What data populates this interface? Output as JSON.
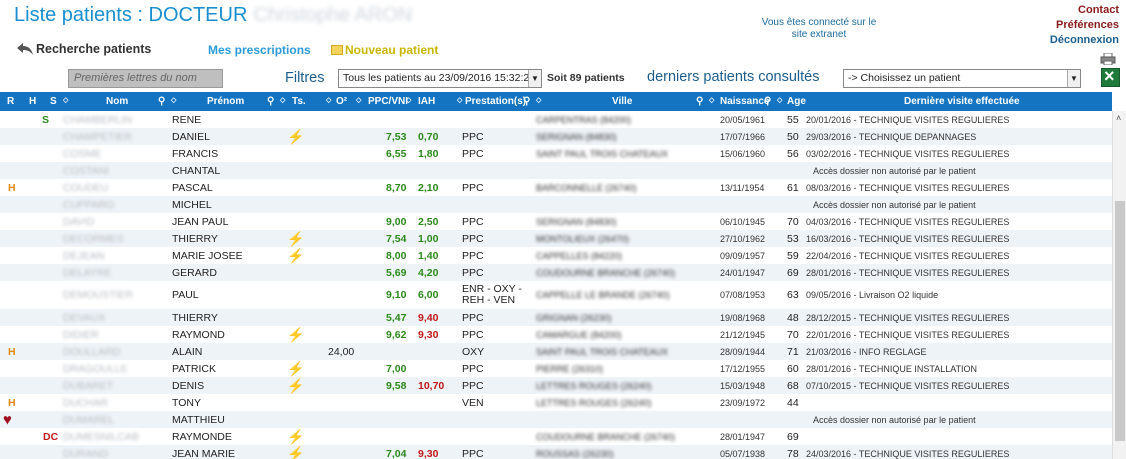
{
  "header": {
    "title": "Liste patients : DOCTEUR",
    "doctor_name": "Christophe ARON",
    "connected": "Vous êtes connecté sur le site extranet",
    "links": {
      "contact": "Contact",
      "preferences": "Préférences",
      "logout": "Déconnexion"
    }
  },
  "toolbar": {
    "back": "Recherche patients",
    "prescriptions": "Mes prescriptions",
    "new_patient": "Nouveau patient",
    "search_placeholder": "Premières lettres du nom",
    "filters_label": "Filtres",
    "filter_value": "Tous les patients au 23/09/2016 15:32:29",
    "count": "Soit 89 patients",
    "recent_label": "derniers patients consultés",
    "recent_value": "-> Choisissez un patient"
  },
  "columns": [
    "R",
    "H",
    "S",
    "Nom",
    "Prénom",
    "Ts.",
    "O²",
    "PPC/VNI",
    "IAH",
    "Prestation(s)",
    "Ville",
    "Naissance",
    "Age",
    "Dernière visite effectuée"
  ],
  "rows": [
    {
      "flag": "S",
      "flag_type": "S",
      "nom": "CHAMBERLIN",
      "prenom": "RENE",
      "ts": false,
      "o2": "",
      "ppc": "",
      "iah": "",
      "iah_red": false,
      "prest": "",
      "ville": "CARPENTRAS (84200)",
      "naissance": "20/05/1961",
      "age": "55",
      "visite": "20/01/2016 - TECHNIQUE VISITES REGULIERES"
    },
    {
      "flag": "",
      "flag_type": "",
      "nom": "CHAMPETIER",
      "prenom": "DANIEL",
      "ts": true,
      "o2": "",
      "ppc": "7,53",
      "iah": "0,70",
      "iah_red": false,
      "prest": "PPC",
      "ville": "SERIGNAN (84830)",
      "naissance": "17/07/1966",
      "age": "50",
      "visite": "29/03/2016 - TECHNIQUE DEPANNAGES"
    },
    {
      "flag": "",
      "flag_type": "",
      "nom": "COSME",
      "prenom": "FRANCIS",
      "ts": false,
      "o2": "",
      "ppc": "6,55",
      "iah": "1,80",
      "iah_red": false,
      "prest": "PPC",
      "ville": "SAINT PAUL TROIS CHATEAUX",
      "naissance": "15/06/1960",
      "age": "56",
      "visite": "03/02/2016 - TECHNIQUE VISITES REGULIERES"
    },
    {
      "flag": "",
      "flag_type": "",
      "nom": "COSTANI",
      "prenom": "CHANTAL",
      "ts": false,
      "o2": "",
      "ppc": "",
      "iah": "",
      "iah_red": false,
      "prest": "",
      "ville": "",
      "naissance": "",
      "age": "",
      "visite": "Accès dossier non autorisé par le patient"
    },
    {
      "flag": "H",
      "flag_type": "H",
      "nom": "COUDEU",
      "prenom": "PASCAL",
      "ts": false,
      "o2": "",
      "ppc": "8,70",
      "iah": "2,10",
      "iah_red": false,
      "prest": "PPC",
      "ville": "BARCONNELLE (26740)",
      "naissance": "13/11/1954",
      "age": "61",
      "visite": "08/03/2016 - TECHNIQUE VISITES REGULIERES"
    },
    {
      "flag": "",
      "flag_type": "",
      "nom": "CUPPARO",
      "prenom": "MICHEL",
      "ts": false,
      "o2": "",
      "ppc": "",
      "iah": "",
      "iah_red": false,
      "prest": "",
      "ville": "",
      "naissance": "",
      "age": "",
      "visite": "Accès dossier non autorisé par le patient"
    },
    {
      "flag": "",
      "flag_type": "",
      "nom": "DAVID",
      "prenom": "JEAN PAUL",
      "ts": false,
      "o2": "",
      "ppc": "9,00",
      "iah": "2,50",
      "iah_red": false,
      "prest": "PPC",
      "ville": "SERIGNAN (84830)",
      "naissance": "06/10/1945",
      "age": "70",
      "visite": "04/03/2016 - TECHNIQUE VISITES REGULIERES"
    },
    {
      "flag": "",
      "flag_type": "",
      "nom": "DECORMES",
      "prenom": "THIERRY",
      "ts": true,
      "o2": "",
      "ppc": "7,54",
      "iah": "1,00",
      "iah_red": false,
      "prest": "PPC",
      "ville": "MONTOLIEUX (26470)",
      "naissance": "27/10/1962",
      "age": "53",
      "visite": "16/03/2016 - TECHNIQUE VISITES REGULIERES"
    },
    {
      "flag": "",
      "flag_type": "",
      "nom": "DEJEAN",
      "prenom": "MARIE JOSEE",
      "ts": true,
      "o2": "",
      "ppc": "8,00",
      "iah": "1,40",
      "iah_red": false,
      "prest": "PPC",
      "ville": "CAPPELLES (84220)",
      "naissance": "09/09/1957",
      "age": "59",
      "visite": "22/04/2016 - TECHNIQUE VISITES REGULIERES"
    },
    {
      "flag": "",
      "flag_type": "",
      "nom": "DELAYRE",
      "prenom": "GERARD",
      "ts": false,
      "o2": "",
      "ppc": "5,69",
      "iah": "4,20",
      "iah_red": false,
      "prest": "PPC",
      "ville": "COUDOURNE BRANCHE (26740)",
      "naissance": "24/01/1947",
      "age": "69",
      "visite": "28/01/2016 - TECHNIQUE VISITES REGULIERES"
    },
    {
      "flag": "",
      "flag_type": "",
      "nom": "DEMOUSTIER",
      "prenom": "PAUL",
      "ts": false,
      "o2": "",
      "ppc": "9,10",
      "iah": "6,00",
      "iah_red": false,
      "prest": "ENR - OXY - REH - VEN",
      "ville": "CAPPELLE LE BRANDE (26740)",
      "naissance": "07/08/1953",
      "age": "63",
      "visite": "09/05/2016 - Livraison O2 liquide"
    },
    {
      "flag": "",
      "flag_type": "",
      "nom": "DEVAUX",
      "prenom": "THIERRY",
      "ts": false,
      "o2": "",
      "ppc": "5,47",
      "iah": "9,40",
      "iah_red": true,
      "prest": "PPC",
      "ville": "GRIGNAN (26230)",
      "naissance": "19/08/1968",
      "age": "48",
      "visite": "28/12/2015 - TECHNIQUE VISITES REGULIERES"
    },
    {
      "flag": "",
      "flag_type": "",
      "nom": "DIDIER",
      "prenom": "RAYMOND",
      "ts": true,
      "o2": "",
      "ppc": "9,62",
      "iah": "9,30",
      "iah_red": true,
      "prest": "PPC",
      "ville": "CAMARGUE (84200)",
      "naissance": "21/12/1945",
      "age": "70",
      "visite": "22/01/2016 - TECHNIQUE VISITES REGULIERES"
    },
    {
      "flag": "H",
      "flag_type": "H",
      "nom": "DOULLARD",
      "prenom": "ALAIN",
      "ts": false,
      "o2": "24,00",
      "ppc": "",
      "iah": "",
      "iah_red": false,
      "prest": "OXY",
      "ville": "SAINT PAUL TROIS CHATEAUX",
      "naissance": "28/09/1944",
      "age": "71",
      "visite": "21/03/2016 - INFO REGLAGE"
    },
    {
      "flag": "",
      "flag_type": "",
      "nom": "DRAGOULLE",
      "prenom": "PATRICK",
      "ts": true,
      "o2": "",
      "ppc": "7,00",
      "iah": "",
      "iah_red": false,
      "prest": "PPC",
      "ville": "PIERRE (26310)",
      "naissance": "17/12/1955",
      "age": "60",
      "visite": "28/01/2016 - TECHNIQUE INSTALLATION"
    },
    {
      "flag": "",
      "flag_type": "",
      "nom": "DUBARET",
      "prenom": "DENIS",
      "ts": true,
      "o2": "",
      "ppc": "9,58",
      "iah": "10,70",
      "iah_red": true,
      "prest": "PPC",
      "ville": "LETTRES ROUGES (26240)",
      "naissance": "15/03/1948",
      "age": "68",
      "visite": "07/10/2015 - TECHNIQUE VISITES REGULIERES"
    },
    {
      "flag": "H",
      "flag_type": "H",
      "nom": "DUCHAR",
      "prenom": "TONY",
      "ts": false,
      "o2": "",
      "ppc": "",
      "iah": "",
      "iah_red": false,
      "prest": "VEN",
      "ville": "LETTRES ROUGES (26240)",
      "naissance": "23/09/1972",
      "age": "44",
      "visite": ""
    },
    {
      "flag": "heart",
      "flag_type": "heart",
      "nom": "DUMAREL",
      "prenom": "MATTHIEU",
      "ts": false,
      "o2": "",
      "ppc": "",
      "iah": "",
      "iah_red": false,
      "prest": "",
      "ville": "",
      "naissance": "",
      "age": "",
      "visite": "Accès dossier non autorisé par le patient"
    },
    {
      "flag": "DC",
      "flag_type": "DC",
      "nom": "DUMESNILCAB",
      "prenom": "RAYMONDE",
      "ts": true,
      "o2": "",
      "ppc": "",
      "iah": "",
      "iah_red": false,
      "prest": "",
      "ville": "COUDOURNE BRANCHE (26740)",
      "naissance": "28/01/1947",
      "age": "69",
      "visite": ""
    },
    {
      "flag": "",
      "flag_type": "",
      "nom": "DURAND",
      "prenom": "JEAN MARIE",
      "ts": true,
      "o2": "",
      "ppc": "7,04",
      "iah": "9,30",
      "iah_red": true,
      "prest": "PPC",
      "ville": "ROUSSAS (26230)",
      "naissance": "05/07/1938",
      "age": "78",
      "visite": "24/03/2016 - TECHNIQUE VISITES REGULIERES"
    }
  ]
}
